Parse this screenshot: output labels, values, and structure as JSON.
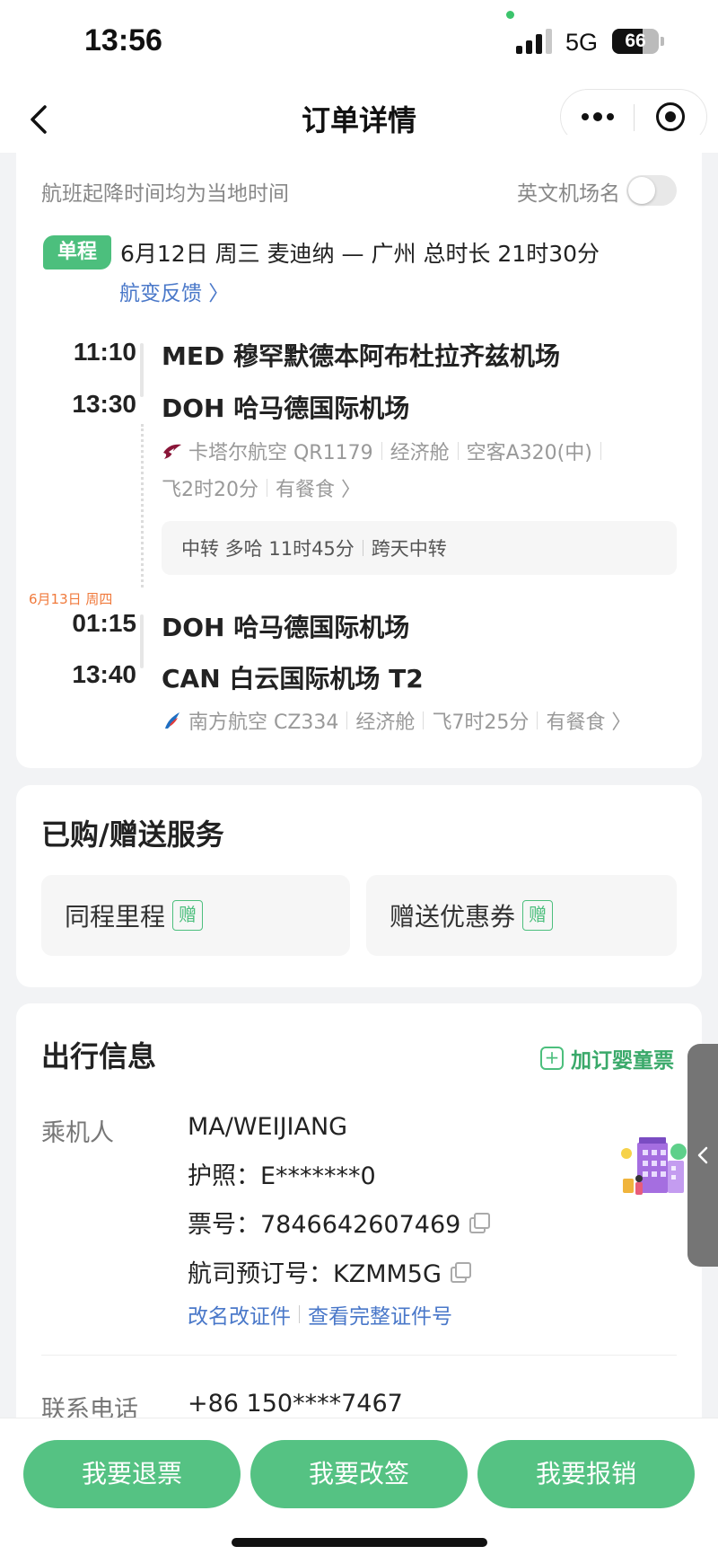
{
  "status_bar": {
    "time": "13:56",
    "network": "5G",
    "battery": "66",
    "battery_level": 0.66
  },
  "nav": {
    "title": "订单详情"
  },
  "flight_card": {
    "hint": "航班起降时间均为当地时间",
    "english_airport_label": "英文机场名",
    "english_airport_toggle": "off",
    "trip_type": "单程",
    "summary": "6月12日 周三 麦迪纳 — 广州 总时长 21时30分",
    "feedback_link": "航变反馈 〉",
    "segments": [
      {
        "dep_time": "11:10",
        "dep_airport": "MED 穆罕默德本阿布杜拉齐兹机场",
        "arr_time": "13:30",
        "arr_airport": "DOH 哈马德国际机场",
        "airline": "卡塔尔航空 QR1179",
        "cabin": "经济舱",
        "aircraft": "空客A320(中)",
        "duration": "飞2时20分",
        "meal": "有餐食 〉",
        "airline_color": "#8a1538"
      },
      {
        "date_tag": "6月13日 周四",
        "dep_time": "01:15",
        "dep_airport": "DOH 哈马德国际机场",
        "arr_time": "13:40",
        "arr_airport": "CAN 白云国际机场 T2",
        "airline": "南方航空 CZ334",
        "cabin": "经济舱",
        "duration": "飞7时25分",
        "meal": "有餐食 〉",
        "airline_color": "#1f6fc2"
      }
    ],
    "transfer": {
      "label": "中转 多哈 11时45分",
      "note": "跨天中转"
    }
  },
  "services": {
    "title": "已购/赠送服务",
    "items": [
      {
        "label": "同程里程",
        "tag": "赠"
      },
      {
        "label": "赠送优惠券",
        "tag": "赠"
      }
    ]
  },
  "travel_info": {
    "title": "出行信息",
    "add_infant": "加订婴童票",
    "passenger_label": "乘机人",
    "passenger_name": "MA/WEIJIANG",
    "passport": "护照：E*******0",
    "ticket_no": "票号：7846642607469",
    "airline_booking": "航司预订号：KZMM5G",
    "rename_link": "改名改证件",
    "view_id_link": "查看完整证件号",
    "phone_label": "联系电话",
    "phone": "+86 150****7467"
  },
  "actions": {
    "refund": "我要退票",
    "change": "我要改签",
    "reimburse": "我要报销"
  },
  "colors": {
    "accent": "#55c283",
    "link": "#4a78c9",
    "date_tag": "#f07a3c"
  }
}
